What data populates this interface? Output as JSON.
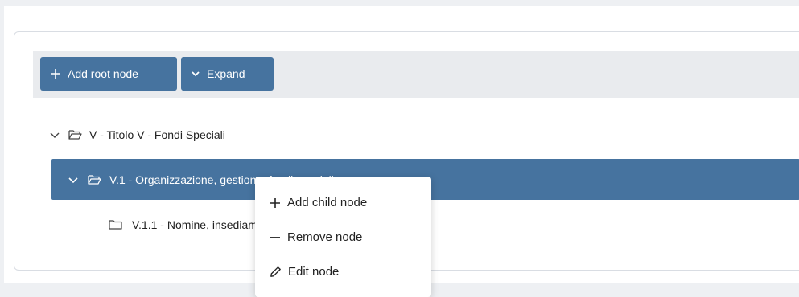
{
  "toolbar": {
    "add_root_label": "Add root node",
    "expand_label": "Expand"
  },
  "tree": {
    "root": {
      "label": "V - Titolo V - Fondi Speciali",
      "icon": "folder-open-icon",
      "expanded": true
    },
    "selected": {
      "label": "V.1 - Organizzazione, gestione, fondi speciali",
      "icon": "folder-open-icon",
      "expanded": true
    },
    "child": {
      "label": "V.1.1 - Nomine, insediamenti, rinnovi, incompatibilità",
      "icon": "folder-icon"
    }
  },
  "context_menu": {
    "items": [
      {
        "label": "Add child node",
        "icon": "plus-icon"
      },
      {
        "label": "Remove node",
        "icon": "minus-icon"
      },
      {
        "label": "Edit node",
        "icon": "pencil-icon"
      }
    ]
  },
  "colors": {
    "accent": "#46739f",
    "toolbar_bg": "#e9ebee",
    "page_bg": "#eef0f3"
  }
}
